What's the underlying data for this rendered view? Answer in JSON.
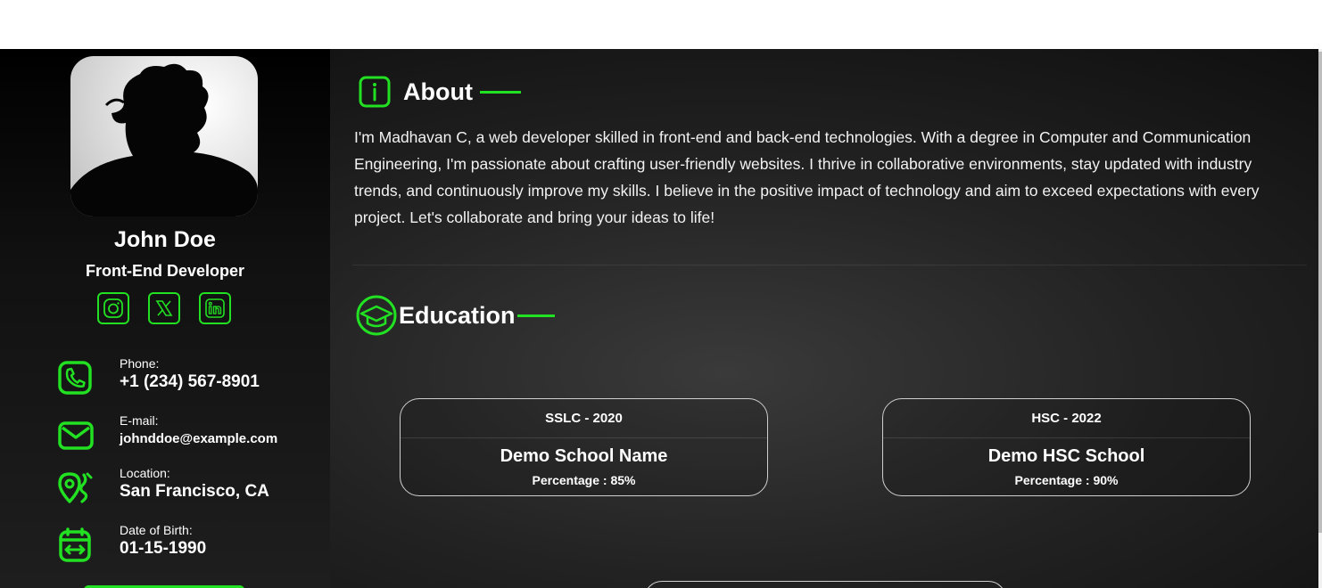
{
  "profile": {
    "name": "John Doe",
    "role": "Front-End Developer",
    "avatar_icon": "person-silhouette-photo",
    "socials": [
      {
        "icon": "instagram-icon"
      },
      {
        "icon": "x-twitter-icon"
      },
      {
        "icon": "linkedin-icon"
      }
    ]
  },
  "contacts": {
    "phone": {
      "label": "Phone:",
      "value": "+1 (234) 567-8901",
      "icon": "phone-icon"
    },
    "email": {
      "label": "E-mail:",
      "value": "johnddoe@example.com",
      "icon": "mail-icon"
    },
    "location": {
      "label": "Location:",
      "value": "San Francisco, CA",
      "icon": "location-icon"
    },
    "dob": {
      "label": "Date of Birth:",
      "value": "01-15-1990",
      "icon": "calendar-icon"
    }
  },
  "about": {
    "title": "About",
    "icon": "info-icon",
    "text": "I'm Madhavan C, a web developer skilled in front-end and back-end technologies. With a degree in Computer and Communication Engineering, I'm passionate about crafting user-friendly websites. I thrive in collaborative environments, stay updated with industry trends, and continuously improve my skills. I believe in the positive impact of technology and aim to exceed expectations with every project. Let's collaborate and bring your ideas to life!"
  },
  "education": {
    "title": "Education",
    "icon": "graduation-cap-icon",
    "cards": [
      {
        "head": "SSLC - 2020",
        "school": "Demo School Name",
        "percentage": "Percentage : 85%"
      },
      {
        "head": "HSC - 2022",
        "school": "Demo HSC School",
        "percentage": "Percentage : 90%"
      }
    ]
  },
  "colors": {
    "accent": "#22e022",
    "background": "#1e1e1e",
    "text": "#ffffff"
  }
}
